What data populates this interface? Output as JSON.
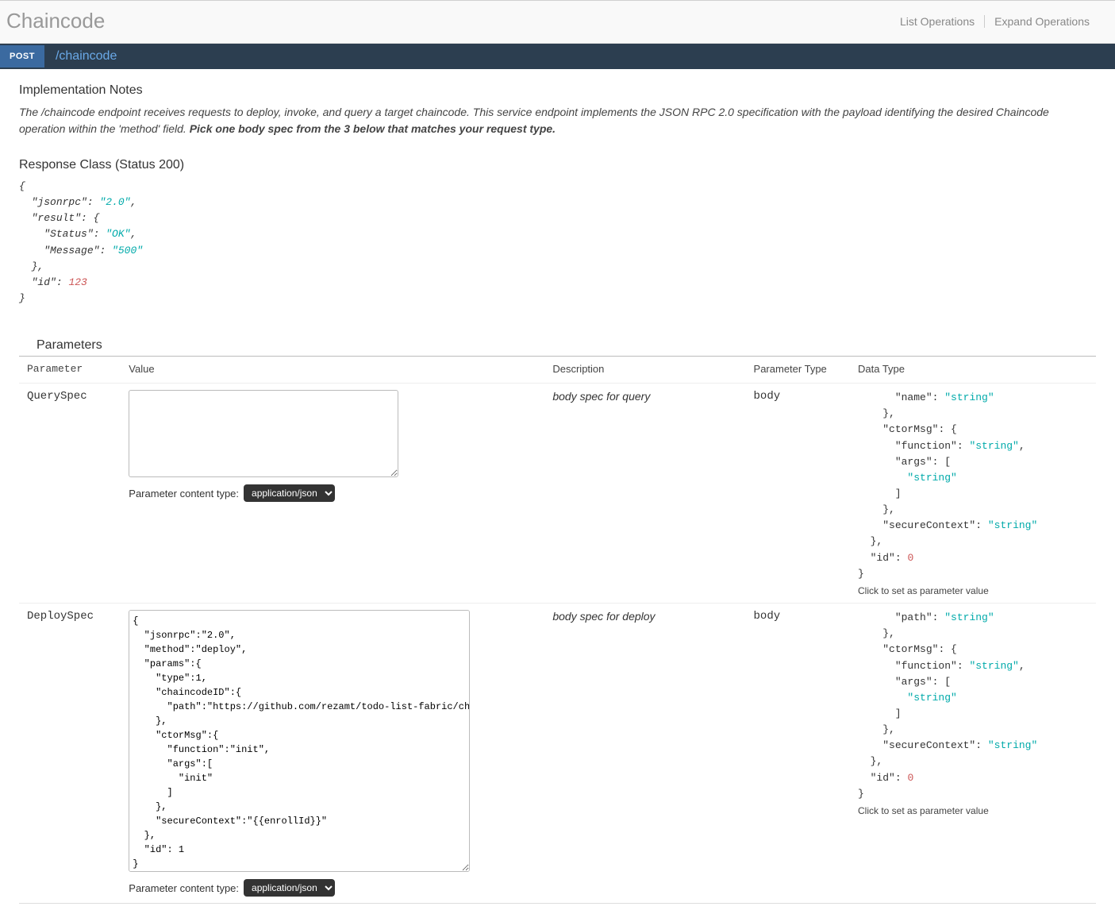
{
  "header": {
    "title": "Chaincode",
    "list_operations": "List Operations",
    "expand_operations": "Expand Operations"
  },
  "endpoint": {
    "method": "POST",
    "path": "/chaincode"
  },
  "notes": {
    "heading": "Implementation Notes",
    "body_plain": "The /chaincode endpoint receives requests to deploy, invoke, and query a target chaincode. This service endpoint implements the JSON RPC 2.0 specification with the payload identifying the desired Chaincode operation within the 'method' field. ",
    "body_bold": "Pick one body spec from the 3 below that matches your request type."
  },
  "response": {
    "heading": "Response Class (Status 200)"
  },
  "params_heading": "Parameters",
  "columns": {
    "parameter": "Parameter",
    "value": "Value",
    "description": "Description",
    "param_type": "Parameter Type",
    "data_type": "Data Type"
  },
  "content_type_label": "Parameter content type:",
  "content_type_value": "application/json",
  "dt_caption": "Click to set as parameter value",
  "rows": [
    {
      "param": "QuerySpec",
      "value": "",
      "desc": "body spec for query",
      "ptype": "body"
    },
    {
      "param": "DeploySpec",
      "value": "{\n  \"jsonrpc\":\"2.0\",\n  \"method\":\"deploy\",\n  \"params\":{\n    \"type\":1,\n    \"chaincodeID\":{\n      \"path\":\"https://github.com/rezamt/todo-list-fabric/chaincode\"\n    },\n    \"ctorMsg\":{\n      \"function\":\"init\",\n      \"args\":[\n        \"init\"\n      ]\n    },\n    \"secureContext\":\"{{enrollId}}\"\n  },\n  \"id\": 1\n}",
      "desc": "body spec for deploy",
      "ptype": "body"
    }
  ]
}
